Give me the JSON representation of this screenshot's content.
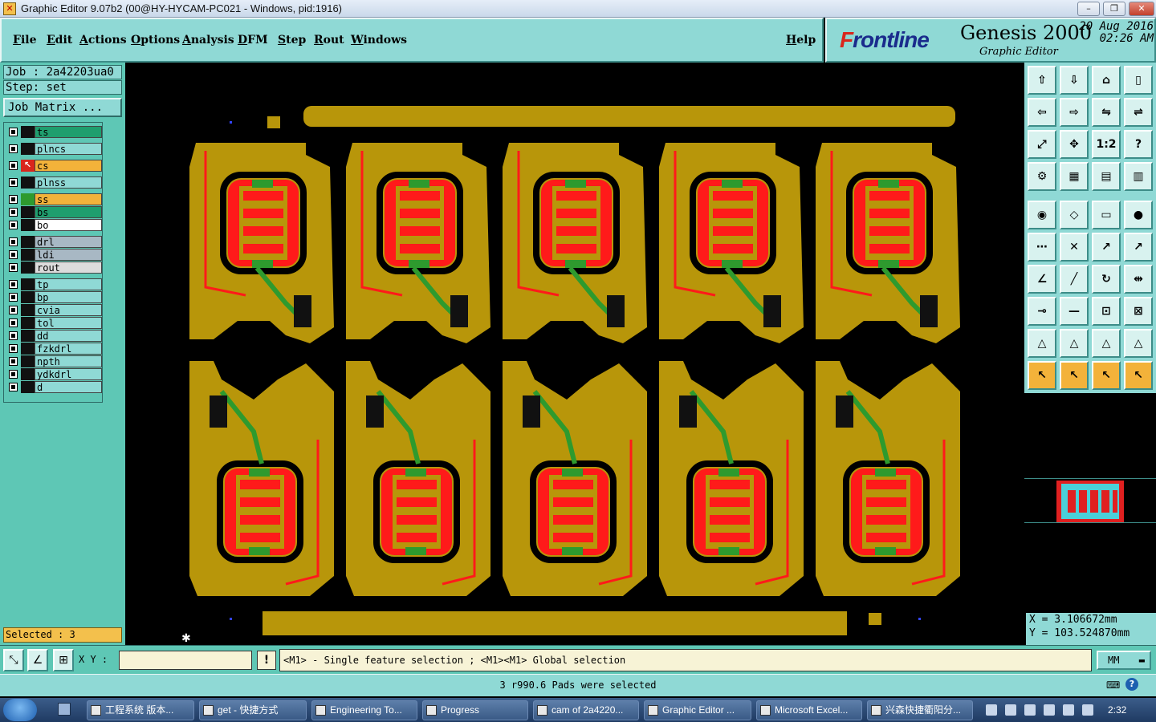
{
  "window": {
    "title": "Graphic Editor 9.07b2 (00@HY-HYCAM-PC021 - Windows, pid:1916)",
    "minimize": "–",
    "maximize": "❐",
    "close": "✕"
  },
  "menu": [
    "File",
    "Edit",
    "Actions",
    "Options",
    "Analysis",
    "DFM",
    "Step",
    "Rout",
    "Windows"
  ],
  "help": "Help",
  "logo": {
    "brand": "Frontline",
    "product": "Genesis 2000",
    "subtitle": "Graphic Editor",
    "date": "20 Aug 2016",
    "time": "02:26 AM"
  },
  "job": {
    "job": "Job : 2a42203ua0",
    "step": "Step: set",
    "matrix_button": "Job Matrix ..."
  },
  "layers": [
    {
      "name": "ts",
      "color": "#1f9e6e"
    },
    {
      "name": "plncs",
      "color": "#8fd9d5"
    },
    {
      "name": "cs",
      "color": "#f3b23a"
    },
    {
      "name": "plnss",
      "color": "#8fd9d5"
    },
    {
      "name": "ss",
      "color": "#f3b23a"
    },
    {
      "name": "bs",
      "color": "#1f9e6e"
    },
    {
      "name": "bo",
      "color": "#ffffff"
    },
    {
      "name": "drl",
      "color": "#a8b8c4"
    },
    {
      "name": "ldi",
      "color": "#a8b8c4"
    },
    {
      "name": "rout",
      "color": "#dcdcdc"
    },
    {
      "name": "tp",
      "color": "#8fd9d5"
    },
    {
      "name": "bp",
      "color": "#8fd9d5"
    },
    {
      "name": "cvia",
      "color": "#8fd9d5"
    },
    {
      "name": "tol",
      "color": "#8fd9d5"
    },
    {
      "name": "dd",
      "color": "#8fd9d5"
    },
    {
      "name": "fzkdrl",
      "color": "#8fd9d5"
    },
    {
      "name": "npth",
      "color": "#8fd9d5"
    },
    {
      "name": "ydkdrl",
      "color": "#8fd9d5"
    },
    {
      "name": "d",
      "color": "#8fd9d5"
    }
  ],
  "selected": "Selected : 3",
  "colors": {
    "board": "#b8960a",
    "copper_red": "#ff1a1a",
    "copper_green": "#2e9a2e",
    "mask": "#000000"
  },
  "coords": {
    "x": "X = 3.106672mm",
    "y": "Y = 103.524870mm"
  },
  "bottom": {
    "xy_label": "X Y :",
    "xy_value": "",
    "excl": "!",
    "hint": "<M1> - Single feature selection ; <M1><M1> Global selection",
    "units": "MM"
  },
  "status": "3 r990.6 Pads were selected",
  "taskbar": {
    "items": [
      "工程系统  版本...",
      "get - 快捷方式",
      "Engineering To...",
      "Progress",
      "cam of 2a4220...",
      "Graphic Editor ...",
      "Microsoft Excel...",
      "兴森快捷衢阳分..."
    ],
    "clock": "2:32"
  },
  "tools": [
    "snap-icon",
    "zoom-home-icon",
    "home-icon",
    "window-icon",
    "move-left-icon",
    "move-right-icon",
    "mirror-icon",
    "rotate-icon",
    "fit-icon",
    "center-icon",
    "ratio-icon",
    "help-icon",
    "measure-icon",
    "grid-icon",
    "layers-icon",
    "layers2-icon",
    "pad-icon",
    "line-icon",
    "ruler-icon",
    "circle-icon",
    "dots-icon",
    "cross-icon",
    "arrow-icon",
    "arrow2-icon",
    "slash-icon",
    "slash2-icon",
    "arc-icon",
    "split-icon",
    "node-icon",
    "line3-icon",
    "box-icon",
    "rect-icon",
    "tri-icon",
    "tri2-icon",
    "tri3-icon",
    "tri4-icon",
    "pointer-icon",
    "pointer2-icon",
    "pointer3-icon",
    "pointer4-icon"
  ]
}
